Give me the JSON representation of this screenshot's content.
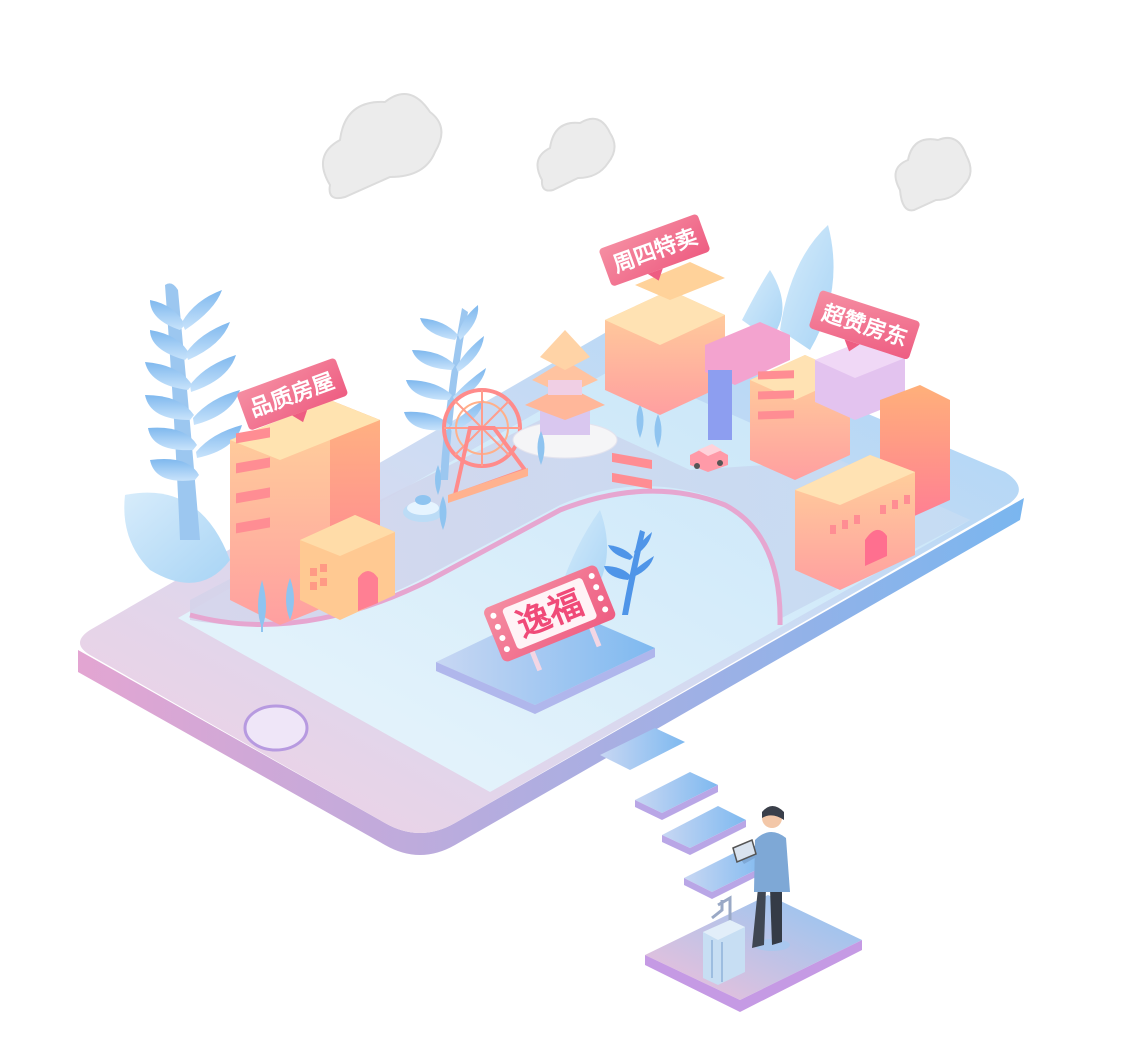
{
  "signs": {
    "quality_housing": "品质房屋",
    "thursday_sale": "周四特卖",
    "super_landlord": "超赞房东",
    "fortune": "逸福"
  },
  "colors": {
    "phone_pink": "#f3c6de",
    "phone_blue": "#8cc8f3",
    "screen": "#dff3fb",
    "sign_red": "#f26b8a",
    "building_light": "#ffd7a0",
    "building_dark": "#ff8b8b",
    "tree_blue": "#8fc7f2",
    "cloud": "#ececec"
  },
  "icons": [
    "cloud-icon",
    "fern-icon",
    "ferris-wheel-icon",
    "pagoda-icon",
    "fountain-icon",
    "car-icon",
    "suitcase-icon",
    "person-with-tablet-icon"
  ]
}
